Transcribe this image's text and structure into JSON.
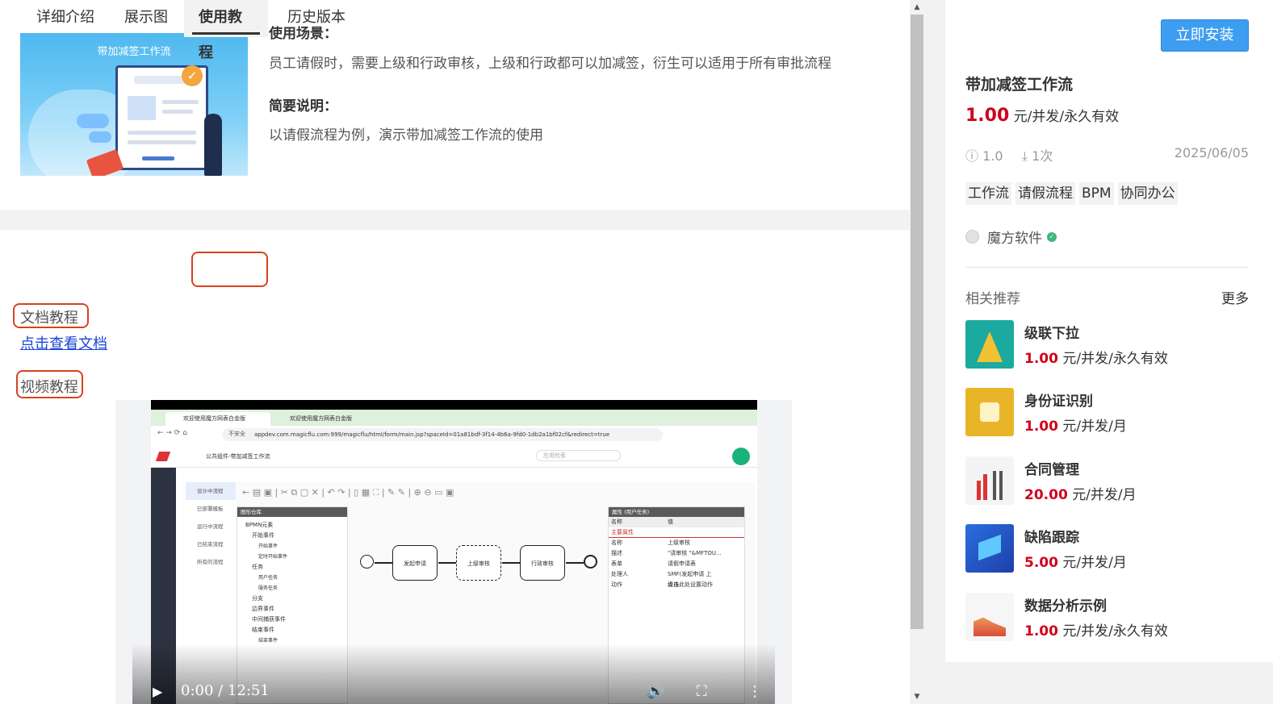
{
  "intro": {
    "cover_title": "带加减签工作流",
    "scene_title": "使用场景：",
    "scene_text": "员工请假时，需要上级和行政审核，上级和行政都可以加减签，衍生可以适用于所有审批流程",
    "brief_title": "简要说明：",
    "brief_text": "以请假流程为例，演示带加减签工作流的使用"
  },
  "tabs": [
    {
      "label": "详细介绍"
    },
    {
      "label": "展示图"
    },
    {
      "label": "使用教程",
      "active": true
    },
    {
      "label": "历史版本"
    }
  ],
  "tutorial": {
    "doc_heading": "文档教程",
    "doc_link": "点击查看文档",
    "video_heading": "视频教程"
  },
  "video": {
    "time": "0:00 / 12:51",
    "browser_tabs": [
      "欢迎使用魔方网表白金版",
      "欢迎使用魔方网表白金版"
    ],
    "url": "appdev.com.magicflu.com:999/magicflu/html/form/main.jsp?spaceId=01a81bdf-3f14-4b6a-9fd0-1db2a1bf02cf&redirect=true",
    "insecure": "不安全",
    "breadcrumb": "公共组件-带加减签工作流",
    "search_placeholder": "应用检索",
    "nav": [
      "设计中流程",
      "已部署模板",
      "运行中流程",
      "已结束流程",
      "所有的流程"
    ],
    "palette_title": "图形仓库",
    "palette_items": [
      "BPMN元素",
      "开始事件",
      "开始事件",
      "定时开始事件",
      "任务",
      "用户任务",
      "服务任务",
      "分支",
      "边界事件",
      "中间捕获事件",
      "结束事件",
      "结束事件"
    ],
    "nodes": [
      "发起申请",
      "上级审核",
      "行政审核"
    ],
    "props_title": "属性 (用户任务)",
    "props_header": [
      "名称",
      "值"
    ],
    "props_section": "主要属性",
    "props_rows": [
      [
        "名称",
        "上级审核"
      ],
      [
        "描述",
        "\"请审核 \"&MFTOU..."
      ],
      [
        "表单",
        "请假申请表"
      ],
      [
        "处理人",
        "SMF(发起申请 上级)$"
      ],
      [
        "动作",
        "点击此处设置动作"
      ]
    ]
  },
  "product": {
    "install_label": "立即安装",
    "title": "带加减签工作流",
    "price": "1.00",
    "price_unit": "元/并发/永久有效",
    "version": "1.0",
    "downloads": "1次",
    "date": "2025/06/05",
    "tags": [
      "工作流",
      "请假流程",
      "BPM",
      "协同办公"
    ],
    "author": "魔方软件"
  },
  "recommend": {
    "heading": "相关推荐",
    "more": "更多",
    "items": [
      {
        "name": "级联下拉",
        "price": "1.00",
        "unit": "元/并发/永久有效"
      },
      {
        "name": "身份证识别",
        "price": "1.00",
        "unit": "元/并发/月"
      },
      {
        "name": "合同管理",
        "price": "20.00",
        "unit": "元/并发/月"
      },
      {
        "name": "缺陷跟踪",
        "price": "5.00",
        "unit": "元/并发/月"
      },
      {
        "name": "数据分析示例",
        "price": "1.00",
        "unit": "元/并发/永久有效"
      }
    ]
  },
  "colors": {
    "accent": "#3d9df0",
    "price": "#d0021b",
    "highlight_box": "#d6431e"
  }
}
